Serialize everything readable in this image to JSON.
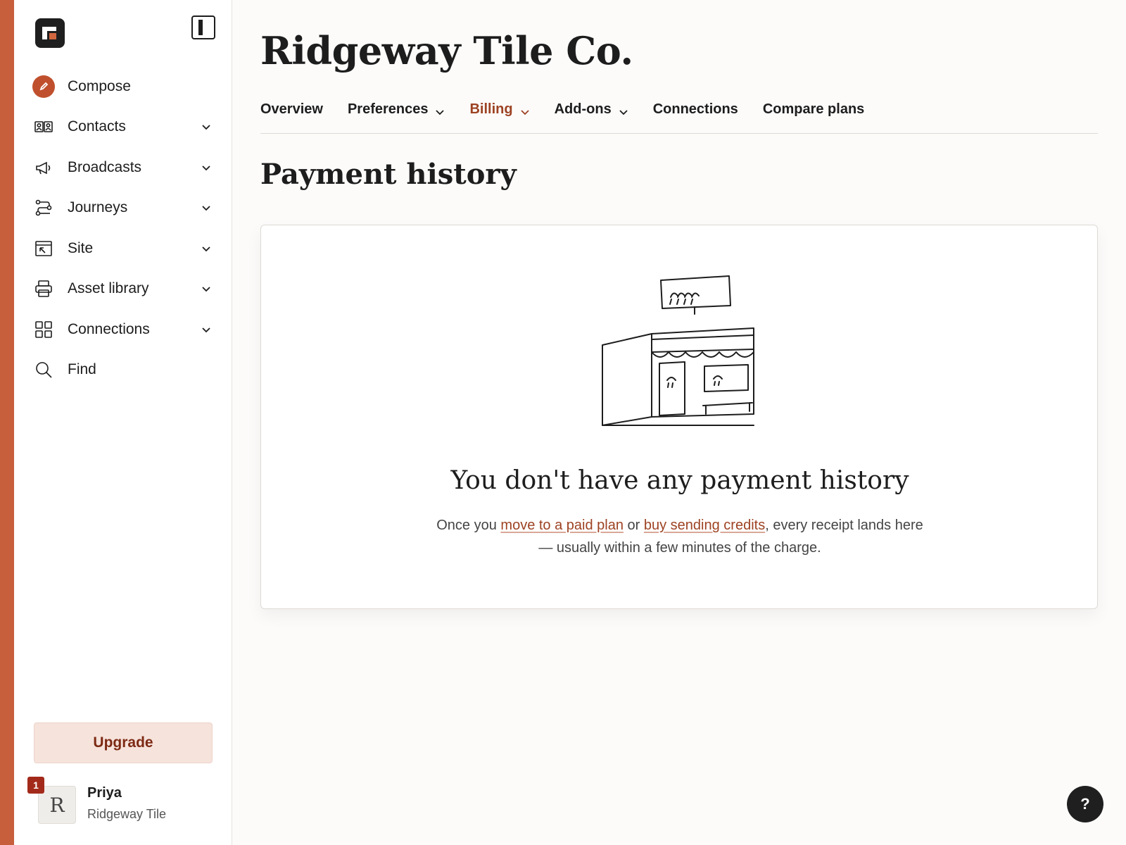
{
  "colors": {
    "accent_bar": "#c75f3d",
    "compose": "#c0502d",
    "active_tab": "#9d4222",
    "link": "#9d4222",
    "upgrade_bg": "#f6e3dc",
    "upgrade_text": "#7d2a14",
    "badge": "#a32a1a"
  },
  "sidebar": {
    "logo_icon": "app-logo-icon",
    "collapse_icon": "sidebar-collapse-icon",
    "items": [
      {
        "label": "Compose",
        "icon": "pencil-icon",
        "has_chevron": false
      },
      {
        "label": "Contacts",
        "icon": "contacts-icon",
        "has_chevron": true
      },
      {
        "label": "Broadcasts",
        "icon": "megaphone-icon",
        "has_chevron": true
      },
      {
        "label": "Journeys",
        "icon": "flow-icon",
        "has_chevron": true
      },
      {
        "label": "Site",
        "icon": "site-icon",
        "has_chevron": true
      },
      {
        "label": "Asset library",
        "icon": "printer-icon",
        "has_chevron": true
      },
      {
        "label": "Connections",
        "icon": "grid-icon",
        "has_chevron": true
      },
      {
        "label": "Find",
        "icon": "search-icon",
        "has_chevron": false
      }
    ],
    "upgrade_label": "Upgrade",
    "user": {
      "initial": "R",
      "name": "Priya",
      "org": "Ridgeway Tile",
      "notification_count": "1"
    }
  },
  "main": {
    "title": "Ridgeway Tile Co.",
    "tabs": [
      {
        "label": "Overview",
        "has_chevron": false,
        "active": false
      },
      {
        "label": "Preferences",
        "has_chevron": true,
        "active": false
      },
      {
        "label": "Billing",
        "has_chevron": true,
        "active": true
      },
      {
        "label": "Add-ons",
        "has_chevron": true,
        "active": false
      },
      {
        "label": "Connections",
        "has_chevron": false,
        "active": false
      },
      {
        "label": "Compare plans",
        "has_chevron": false,
        "active": false
      }
    ],
    "section_title": "Payment history",
    "empty_state": {
      "illustration": "storefront-illustration",
      "title": "You don't have any payment history",
      "desc_before": "Once you ",
      "link1": "move to a paid plan",
      "desc_middle": " or ",
      "link2": "buy sending credits",
      "desc_after": ", every receipt lands here — usually within a few minutes of the charge."
    }
  },
  "help_label": "?"
}
